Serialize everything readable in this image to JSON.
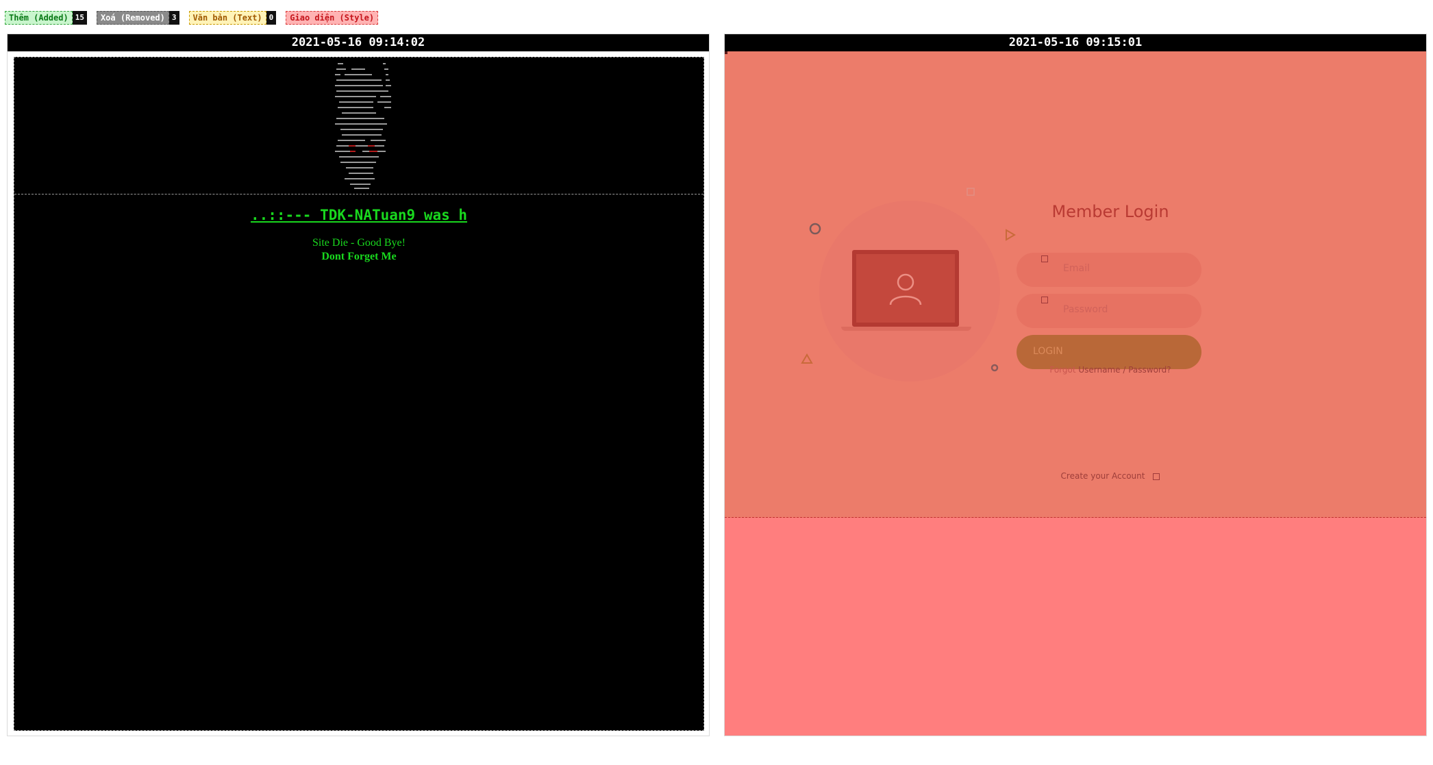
{
  "legend": {
    "added": {
      "label": "Thêm (Added)",
      "count": "15"
    },
    "removed": {
      "label": "Xoá (Removed)",
      "count": "3"
    },
    "text": {
      "label": "Văn bản (Text)",
      "count": "0"
    },
    "style": {
      "label": "Giao diện (Style)"
    }
  },
  "colors": {
    "added": "#c9f5cd",
    "removed": "#8a8a8a",
    "text": "#fff3b8",
    "style": "#ffb3b3",
    "hack_green": "#19d81e",
    "style_overlay": "#ff7e7e"
  },
  "left_panel": {
    "timestamp": "2021-05-16 09:14:02",
    "hack_title": "..::--- TDK-NATuan9 was h",
    "line1": "Site Die - Good Bye!",
    "line2": "Dont Forget Me"
  },
  "right_panel": {
    "timestamp": "2021-05-16 09:15:01",
    "login": {
      "title": "Member Login",
      "email_placeholder": "Email",
      "password_placeholder": "Password",
      "button_label": "LOGIN",
      "forgot_prefix": "Forgot",
      "forgot_link": "Username / Password?",
      "create_account": "Create your Account"
    },
    "icons": [
      "user-icon",
      "laptop-icon",
      "circle-outline-icon",
      "triangle-icon",
      "square-outline-icon",
      "ring-icon"
    ]
  }
}
